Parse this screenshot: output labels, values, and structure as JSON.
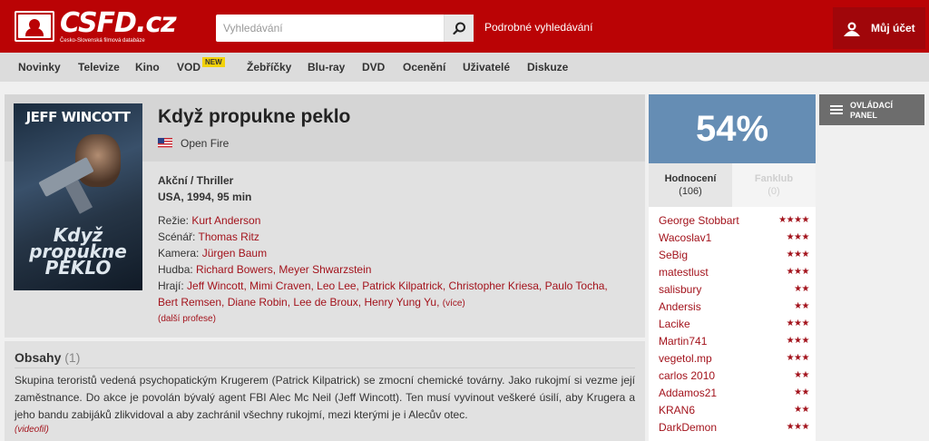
{
  "brand": {
    "logo_text": "CSFD.cz",
    "logo_sub": "Česko-Slovenská filmová databáze"
  },
  "header": {
    "search_placeholder": "Vyhledávání",
    "advanced_search": "Podrobné vyhledávání",
    "account": "Můj účet"
  },
  "nav": {
    "items": [
      {
        "label": "Novinky"
      },
      {
        "label": "Televize"
      },
      {
        "label": "Kino"
      },
      {
        "label": "VOD",
        "badge": "NEW"
      },
      {
        "label": "Žebříčky"
      },
      {
        "label": "Blu-ray"
      },
      {
        "label": "DVD"
      },
      {
        "label": "Ocenění"
      },
      {
        "label": "Uživatelé"
      },
      {
        "label": "Diskuze"
      }
    ]
  },
  "movie": {
    "title": "Když propukne peklo",
    "original_title": "Open Fire",
    "genre": "Akční / Thriller",
    "origin": "USA, 1994, 95 min",
    "credits": [
      {
        "label": "Režie:",
        "value": "Kurt Anderson"
      },
      {
        "label": "Scénář:",
        "value": "Thomas Ritz"
      },
      {
        "label": "Kamera:",
        "value": "Jürgen Baum"
      },
      {
        "label": "Hudba:",
        "value": "Richard Bowers, Meyer Shwarzstein"
      },
      {
        "label": "Hrají:",
        "value": "Jeff Wincott, Mimi Craven, Leo Lee, Patrick Kilpatrick, Christopher Kriesa, Paulo Tocha,"
      },
      {
        "label": "",
        "value": "Bert Remsen, Diane Robin, Lee de Broux, Henry Yung Yu,",
        "more": "(více)"
      }
    ],
    "more_professions": "(další profese)",
    "poster": {
      "actor": "JEFF WINCOTT",
      "title_line1": "Když",
      "title_line2": "propukne",
      "title_line3": "PEKLO"
    }
  },
  "plot": {
    "heading": "Obsahy",
    "count": "(1)",
    "text": "Skupina teroristů vedená psychopatickým Krugerem (Patrick Kilpatrick) se zmocní chemické továrny. Jako rukojmí si vezme její zaměstnance. Do akce je povolán bývalý agent FBI Alec Mc Neil (Jeff Wincott). Ten musí vyvinout veškeré úsilí, aby Krugera a jeho bandu zabijáků zlikvidoval a aby zachránil všechny rukojmí, mezi kterými je i Alecův otec.",
    "source": "(videofil)"
  },
  "rating": {
    "percent": "54%",
    "color": "#658db4",
    "tabs": [
      {
        "label": "Hodnocení",
        "count": "(106)"
      },
      {
        "label": "Fanklub",
        "count": "(0)"
      }
    ],
    "users": [
      {
        "name": "George Stobbart",
        "stars": "★★★★"
      },
      {
        "name": "Wacoslav1",
        "stars": "★★★"
      },
      {
        "name": "SeBig",
        "stars": "★★★"
      },
      {
        "name": "matestlust",
        "stars": "★★★"
      },
      {
        "name": "salisbury",
        "stars": "★★"
      },
      {
        "name": "Andersis",
        "stars": "★★"
      },
      {
        "name": "Lacike",
        "stars": "★★★"
      },
      {
        "name": "Martin741",
        "stars": "★★★"
      },
      {
        "name": "vegetol.mp",
        "stars": "★★★"
      },
      {
        "name": "carlos 2010",
        "stars": "★★"
      },
      {
        "name": "Addamos21",
        "stars": "★★"
      },
      {
        "name": "KRAN6",
        "stars": "★★"
      },
      {
        "name": "DarkDemon",
        "stars": "★★★"
      }
    ]
  },
  "control_panel": {
    "label": "OVLÁDACÍ PANEL"
  },
  "colors": {
    "brand_red": "#ba0305",
    "link": "#a3131c",
    "badge_yellow": "#f2d20a",
    "panel_gray": "#6d6d6d"
  }
}
